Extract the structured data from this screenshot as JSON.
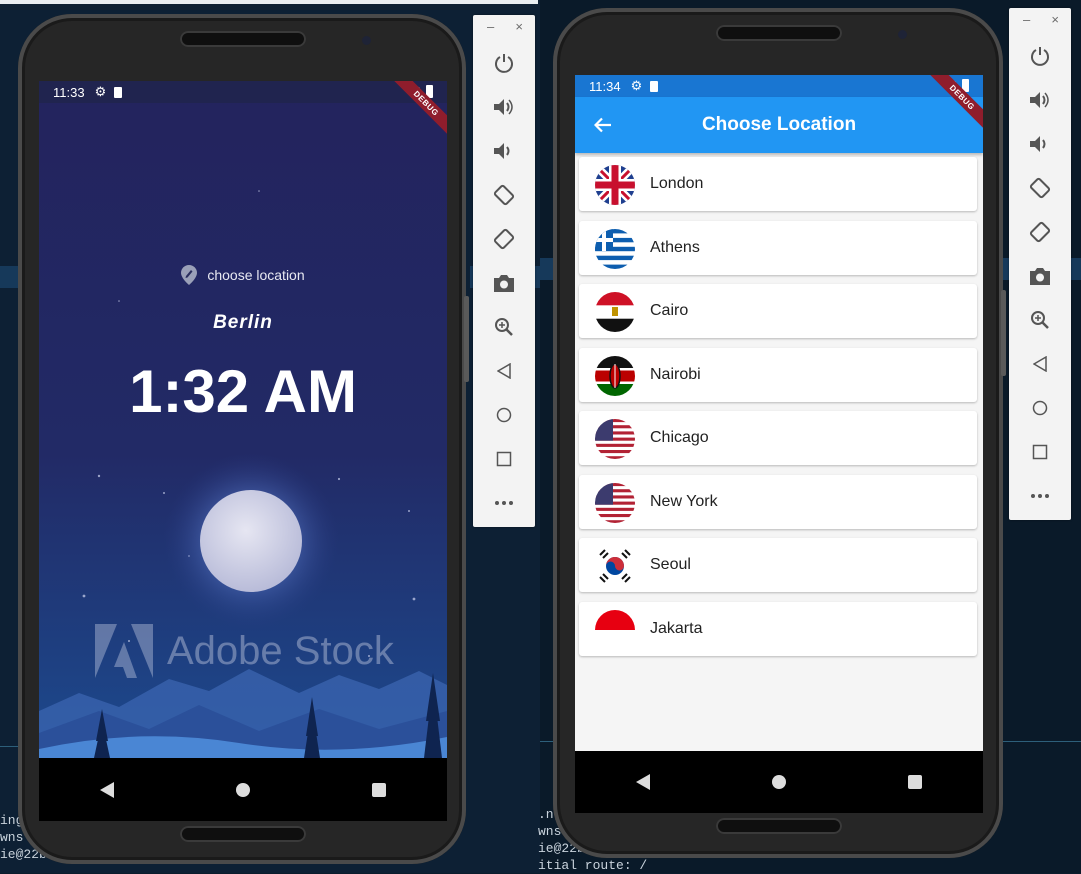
{
  "terminal": {
    "left_lines": [
      "ing",
      "wns t",
      "ie@22b5370"
    ],
    "right_lines": [
      ".ng",
      "wns t",
      "ie@22b5370",
      "itial route: /"
    ]
  },
  "home_screen": {
    "status_time": "11:33",
    "debug_banner": "DEBUG",
    "choose_location_label": "choose location",
    "location": "Berlin",
    "time": "1:32 AM",
    "watermark": "Adobe Stock"
  },
  "choose_screen": {
    "status_time": "11:34",
    "debug_banner": "DEBUG",
    "title": "Choose Location",
    "locations": [
      {
        "name": "London",
        "flag": "uk-flag"
      },
      {
        "name": "Athens",
        "flag": "greece-flag"
      },
      {
        "name": "Cairo",
        "flag": "egypt-flag"
      },
      {
        "name": "Nairobi",
        "flag": "kenya-flag"
      },
      {
        "name": "Chicago",
        "flag": "usa-flag"
      },
      {
        "name": "New York",
        "flag": "usa-flag"
      },
      {
        "name": "Seoul",
        "flag": "korea-flag"
      },
      {
        "name": "Jakarta",
        "flag": "indonesia-flag"
      }
    ]
  },
  "emulator_toolbar": {
    "minimize": "–",
    "close": "×",
    "buttons": [
      "power-icon",
      "volume-up-icon",
      "volume-down-icon",
      "rotate-left-icon",
      "rotate-right-icon",
      "camera-icon",
      "zoom-icon",
      "back-icon",
      "home-icon",
      "overview-icon",
      "more-icon"
    ]
  },
  "colors": {
    "app_bar": "#2196f3",
    "night_sky": "#23235d",
    "list_background": "#f5f5f5"
  }
}
